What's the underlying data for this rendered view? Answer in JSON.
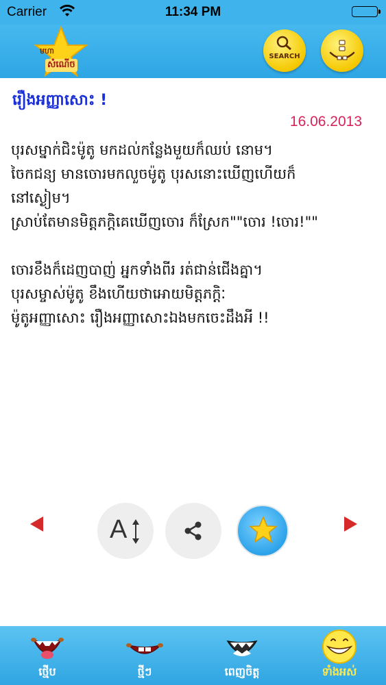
{
  "status_bar": {
    "carrier": "Carrier",
    "time": "11:34 PM",
    "icons": [
      "wifi-icon",
      "battery-icon"
    ]
  },
  "nav_bar": {
    "logo_text_top": "មហា",
    "logo_text_bottom": "សំណើច",
    "search_label": "SEARCH",
    "icons": [
      "star-logo-icon",
      "search-face-icon",
      "menu-face-icon"
    ]
  },
  "story": {
    "title": "រឿងអញ្ញាសោះ !",
    "date": "16.06.2013",
    "body": "បុរសម្នាក់ជិះម៉ូតូ មកដល់កន្លែងមួយក៏ឈប់ នោម។\nចៃកជន្យ មានចោរមកលួចម៉ូតូ បុរសនោះឃើញហើយក៏\nនៅស្ងៀម។\nស្រាប់តែមានមិត្តភក្តិគេឃើញចោរ ក៏ស្រែក\"\"ចោរ !ចោរ!\"\"\n\nចោរខឹងក៏ដេញបាញ់ អ្នកទាំងពីរ រត់ជាន់ជើងគ្នា។\nបុរសម្ចាស់ម៉ូតូ ខឹងហើយថាអោយមិត្តភក្តិៈ\nម៉ូតូអញ្ញាសោះ រឿងអញ្ញាសោះឯងមកចេះដឹងអី !!"
  },
  "toolbar": {
    "font_button_label": "A",
    "icons": [
      "prev-arrow-icon",
      "font-size-icon",
      "share-icon",
      "favorite-star-icon",
      "next-arrow-icon"
    ]
  },
  "tab_bar": {
    "tabs": [
      {
        "label": "ថ្មើប",
        "icon": "laughing-mouth-icon"
      },
      {
        "label": "ថ្មីៗ",
        "icon": "grin-mouth-icon"
      },
      {
        "label": "ពេញចិត្ត",
        "icon": "teeth-mouth-icon"
      },
      {
        "label": "ទាំងអស់",
        "icon": "smiley-face-icon"
      }
    ],
    "active_index": 3
  },
  "colors": {
    "bar_blue": "#3fb4ec",
    "title_blue": "#1a2fd6",
    "date_pink": "#d6245a",
    "arrow_red": "#d62a2a",
    "active_tab_yellow": "#ffe84a"
  }
}
